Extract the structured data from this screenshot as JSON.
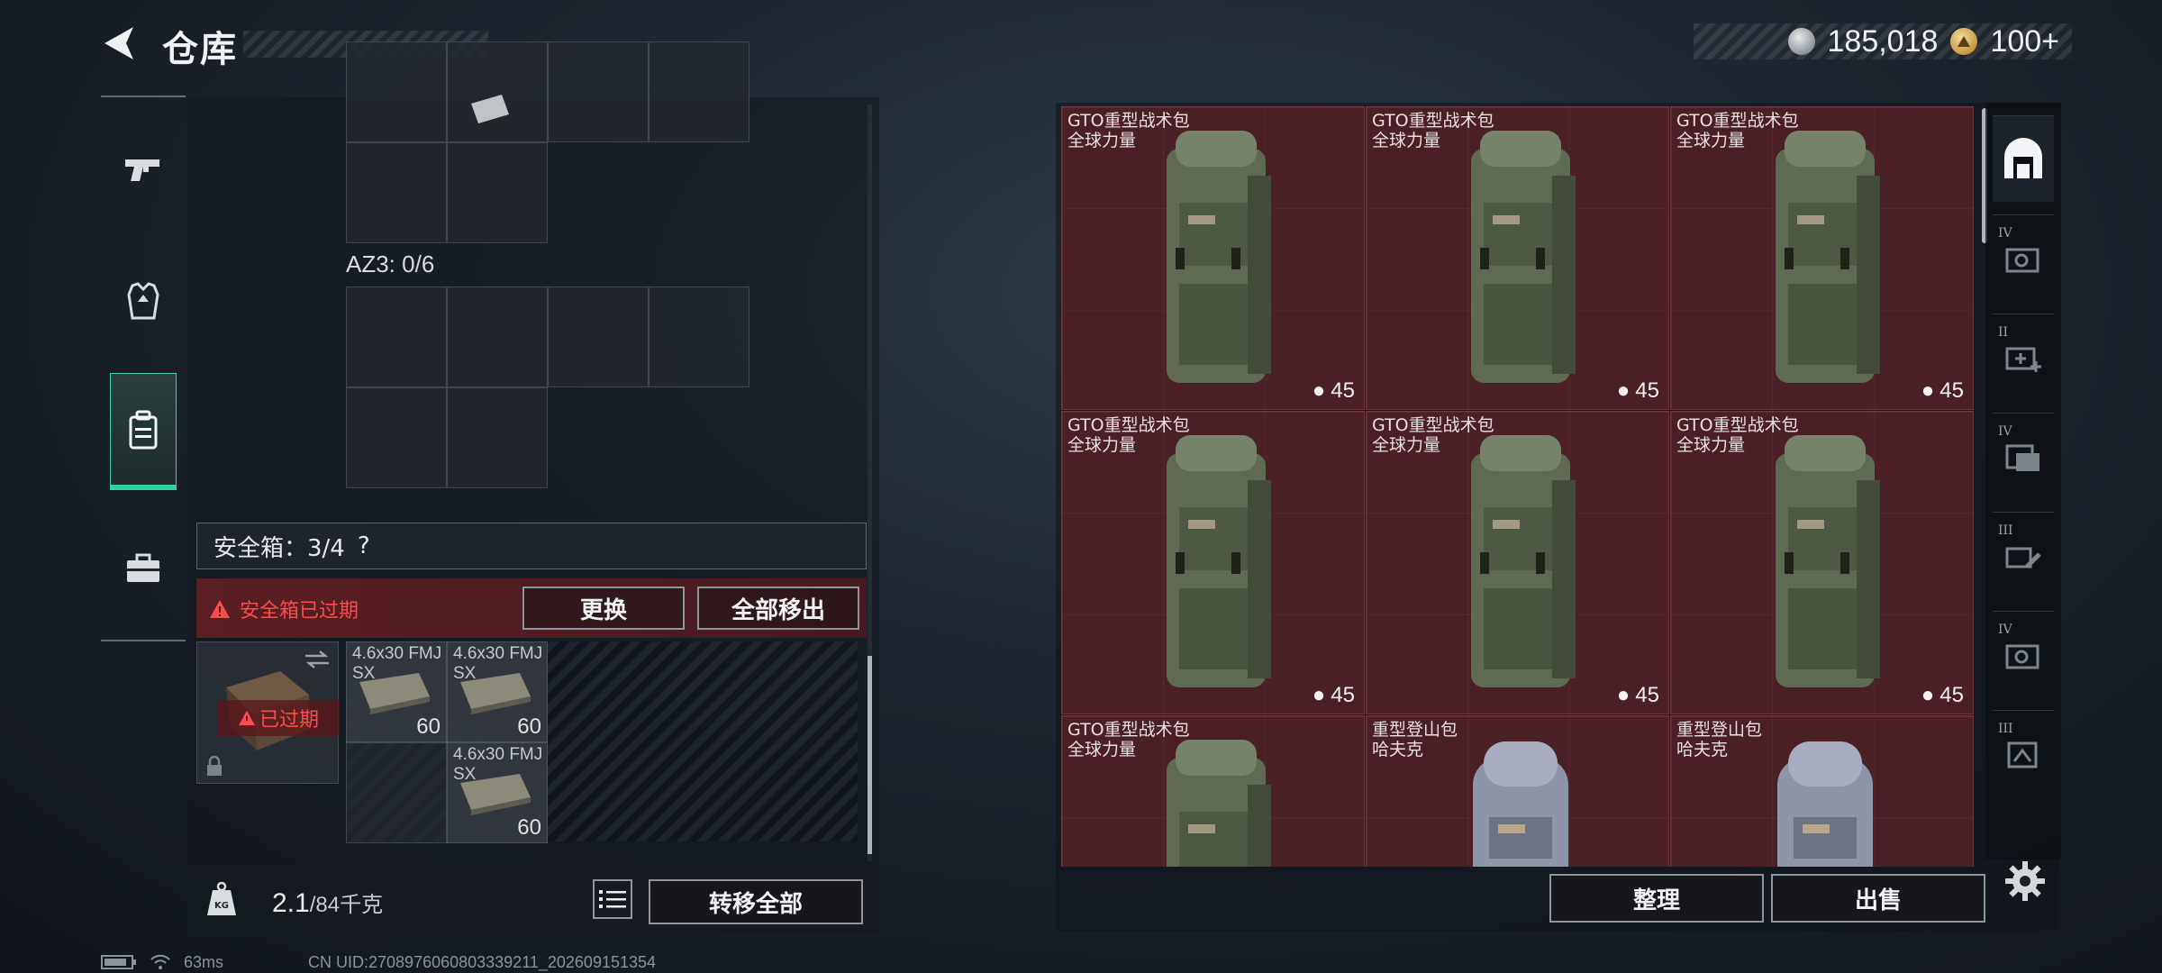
{
  "header": {
    "title": "仓库",
    "currency_silver": "185,018",
    "currency_gold": "100+"
  },
  "left": {
    "az3_label": "AZ3: 0/6",
    "safe_box_label": "安全箱：3/4",
    "help_glyph": "?",
    "expired_warning": "安全箱已过期",
    "replace_button": "更换",
    "remove_all_button": "全部移出",
    "expired_badge": "已过期",
    "ammo": [
      {
        "name": "4.6x30 FMJ SX",
        "count": "60"
      },
      {
        "name": "4.6x30 FMJ SX",
        "count": "60"
      },
      {
        "name": "4.6x30 FMJ SX",
        "count": "60"
      }
    ],
    "weight_value": "2.1",
    "weight_capacity": "/84千克",
    "transfer_all_button": "转移全部"
  },
  "stash": {
    "items": [
      {
        "name": "GTO重型战术包",
        "brand": "全球力量",
        "level": "45",
        "variant": "tactical"
      },
      {
        "name": "GTO重型战术包",
        "brand": "全球力量",
        "level": "45",
        "variant": "tactical"
      },
      {
        "name": "GTO重型战术包",
        "brand": "全球力量",
        "level": "45",
        "variant": "tactical"
      },
      {
        "name": "GTO重型战术包",
        "brand": "全球力量",
        "level": "45",
        "variant": "tactical"
      },
      {
        "name": "GTO重型战术包",
        "brand": "全球力量",
        "level": "45",
        "variant": "tactical"
      },
      {
        "name": "GTO重型战术包",
        "brand": "全球力量",
        "level": "45",
        "variant": "tactical"
      },
      {
        "name": "GTO重型战术包",
        "brand": "全球力量",
        "level": "",
        "variant": "tactical"
      },
      {
        "name": "重型登山包",
        "brand": "哈夫克",
        "level": "",
        "variant": "mountain"
      },
      {
        "name": "重型登山包",
        "brand": "哈夫克",
        "level": "",
        "variant": "mountain"
      }
    ],
    "sort_button": "整理",
    "sell_button": "出售"
  },
  "right_rail": [
    {
      "roman": "",
      "icon": "stash-home-icon"
    },
    {
      "roman": "IV",
      "icon": "gear-repair-icon"
    },
    {
      "roman": "II",
      "icon": "medkit-add-icon"
    },
    {
      "roman": "IV",
      "icon": "folder-stack-icon"
    },
    {
      "roman": "III",
      "icon": "tool-icon"
    },
    {
      "roman": "IV",
      "icon": "gear-repair-icon"
    },
    {
      "roman": "III",
      "icon": "upgrade-box-icon"
    }
  ],
  "footer": {
    "ping": "63ms",
    "uid": "CN UID:2708976060803339211_202609151354"
  },
  "colors": {
    "accent": "#2fd3a3",
    "danger": "#ff4b4b",
    "cell_red": "#4a1f25"
  }
}
